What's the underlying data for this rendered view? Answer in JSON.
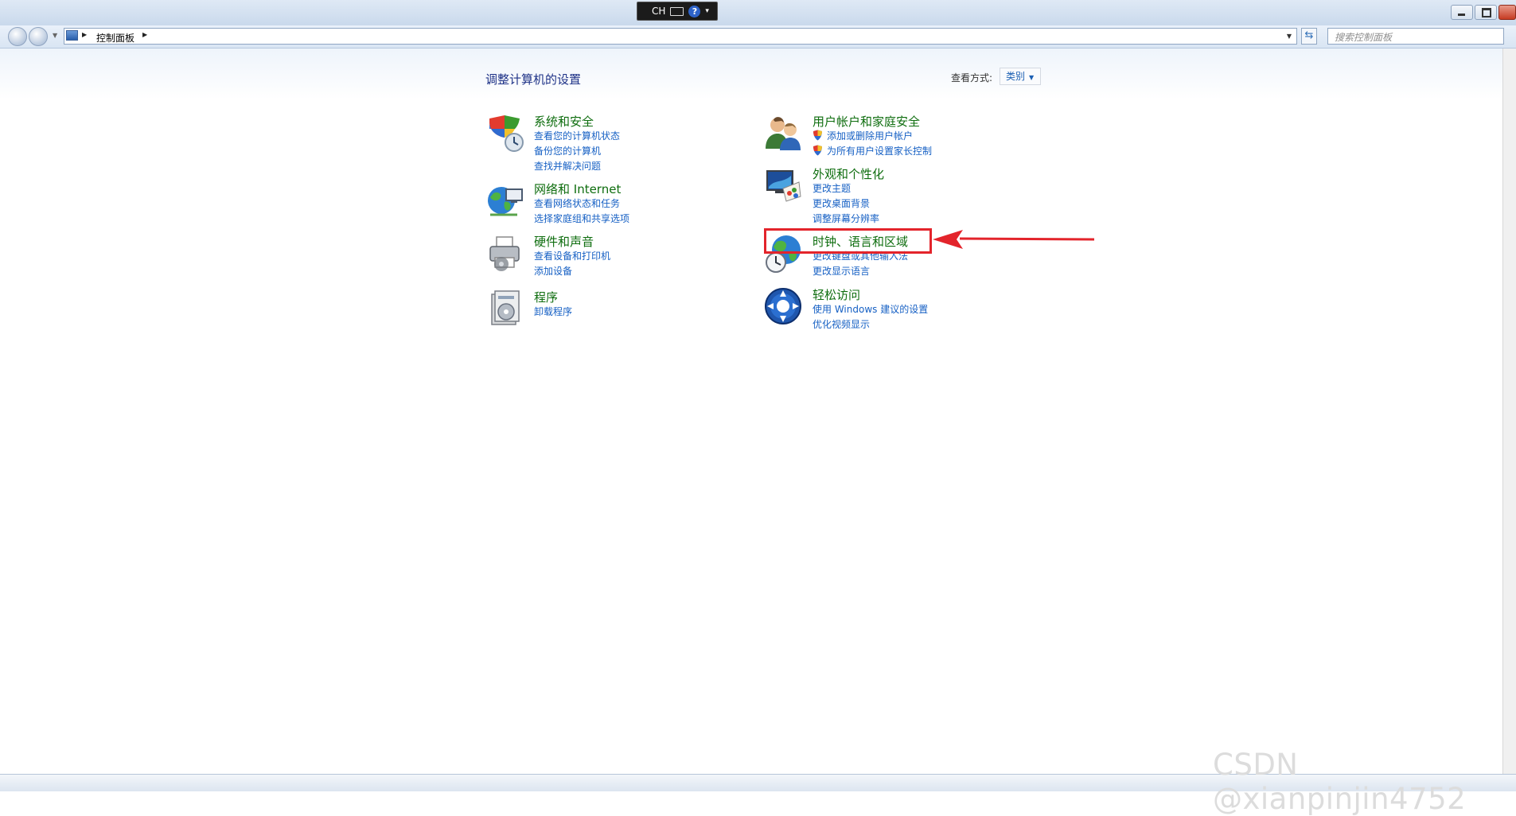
{
  "ime": {
    "label": "CH",
    "help": "?"
  },
  "address": {
    "breadcrumb": [
      "控制面板"
    ]
  },
  "search": {
    "placeholder": "搜索控制面板"
  },
  "page": {
    "title": "调整计算机的设置"
  },
  "view_by": {
    "label": "查看方式:",
    "value": "类别"
  },
  "categories": [
    {
      "title": "系统和安全",
      "icon": "security-shield-icon",
      "links": [
        "查看您的计算机状态",
        "备份您的计算机",
        "查找并解决问题"
      ]
    },
    {
      "title": "网络和 Internet",
      "icon": "network-globe-icon",
      "links": [
        "查看网络状态和任务",
        "选择家庭组和共享选项"
      ]
    },
    {
      "title": "硬件和声音",
      "icon": "printer-icon",
      "links": [
        "查看设备和打印机",
        "添加设备"
      ]
    },
    {
      "title": "程序",
      "icon": "programs-icon",
      "links": [
        "卸载程序"
      ]
    },
    {
      "title": "用户帐户和家庭安全",
      "icon": "users-icon",
      "links": [
        "添加或删除用户帐户",
        "为所有用户设置家长控制"
      ]
    },
    {
      "title": "外观和个性化",
      "icon": "appearance-icon",
      "links": [
        "更改主题",
        "更改桌面背景",
        "调整屏幕分辨率"
      ]
    },
    {
      "title": "时钟、语言和区域",
      "icon": "clock-globe-icon",
      "links": [
        "更改键盘或其他输入法",
        "更改显示语言"
      ]
    },
    {
      "title": "轻松访问",
      "icon": "ease-of-access-icon",
      "links": [
        "使用 Windows 建议的设置",
        "优化视频显示"
      ]
    }
  ],
  "annotation": {
    "color": "#e3242b"
  },
  "watermark": "CSDN @xianpinjin4752",
  "colors": {
    "title_blue": "#1e3287",
    "category_green": "#0e6d0e",
    "link_blue": "#1660c4"
  }
}
